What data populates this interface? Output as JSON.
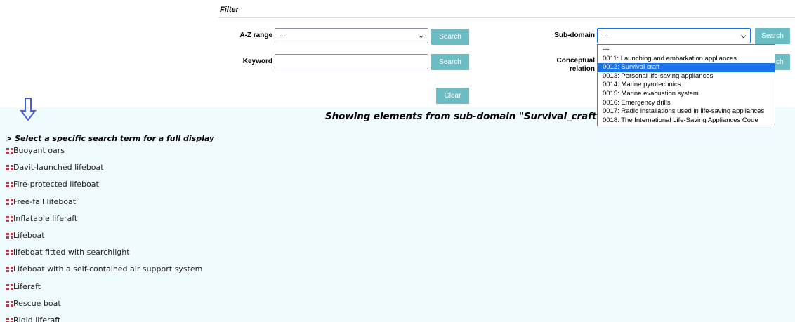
{
  "filter": {
    "title": "Filter",
    "az_range": {
      "label": "A-Z range",
      "value": "---",
      "button": "Search"
    },
    "keyword": {
      "label": "Keyword",
      "value": "",
      "button": "Search"
    },
    "subdomain": {
      "label": "Sub-domain",
      "value": "---",
      "button": "Search"
    },
    "conceptual": {
      "label_line1": "Conceptual",
      "label_line2": "relation",
      "button_partial": "ch"
    },
    "clear_button": "Clear"
  },
  "dropdown": {
    "options": [
      "---",
      "0011: Launching and embarkation appliances",
      "0012: Survival craft",
      "0013: Personal life-saving appliances",
      "0014: Marine pyrotechnics",
      "0015: Marine evacuation system",
      "0016: Emergency drills",
      "0017: Radio installations used in life-saving appliances",
      "0018: The International Life-Saving Appliances Code"
    ],
    "selected_option": "0012: Survival craft"
  },
  "results": {
    "heading": "Showing elements from sub-domain \"Survival_craft\"",
    "hint": "> Select a specific search term for a full display",
    "terms": [
      "Buoyant oars",
      "Davit-launched lifeboat",
      "Fire-protected lifeboat",
      "Free-fall lifeboat",
      "Inflatable liferaft",
      "Lifeboat",
      "lifeboat fitted with searchlight",
      "Lifeboat with a self-contained air support system",
      "Liferaft",
      "Rescue boat",
      "Rigid liferaft"
    ]
  },
  "colors": {
    "button": "#6cbcc4",
    "results_background": "#f0fbfd",
    "selected_option": "#1a73e8",
    "arrow": "#4a5fd4"
  },
  "icons": {
    "arrow": "down-arrow-icon",
    "flag": "uk-flag-icon",
    "chevron": "chevron-down-icon"
  }
}
